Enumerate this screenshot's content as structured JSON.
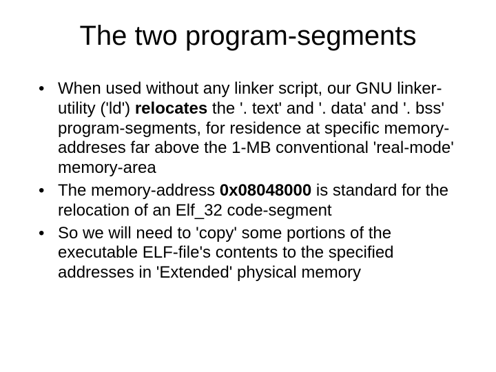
{
  "title": "The two program-segments",
  "bullets": [
    {
      "pre": "When used without any linker script, our GNU linker-utility ('ld') ",
      "bold": "relocates",
      "post": " the '. text' and '. data' and '. bss' program-segments, for residence at specific memory-addreses far above the 1-MB conventional 'real-mode' memory-area"
    },
    {
      "pre": "The memory-address ",
      "bold": "0x08048000",
      "post": " is standard for the relocation of an Elf_32 code-segment"
    },
    {
      "pre": "So we will need to 'copy' some portions of the executable ELF-file's contents to the specified addresses in 'Extended' physical memory",
      "bold": "",
      "post": ""
    }
  ]
}
